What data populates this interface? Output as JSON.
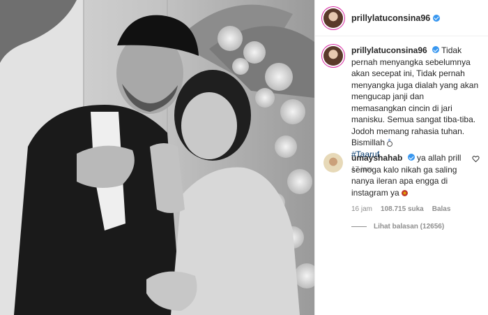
{
  "post": {
    "username": "prillylatuconsina96"
  },
  "caption": {
    "username": "prillylatuconsina96",
    "text": "Tidak pernah menyangka sebelumnya akan secepat ini, Tidak pernah menyangka juga dialah yang akan mengucap janji dan memasangkan cincin di jari manisku. Semua sangat tiba-tiba. Jodoh memang rahasia tuhan. Bismillah",
    "emoji_icon": "ring-icon",
    "hashtag": "#Taaruf",
    "time": "17 jam"
  },
  "comment": {
    "username": "umayshahab",
    "text": "ya allah prill semoga kalo nikah ga saling nanya ileran apa engga di instagram ya",
    "emoji_icon": "flower-icon",
    "time": "16 jam",
    "likes": "108.715 suka",
    "reply_label": "Balas",
    "view_replies": "Lihat balasan (12656)"
  },
  "colors": {
    "verified": "#3897f0",
    "hashtag": "#00376b",
    "muted": "#8e8e8e",
    "text": "#262626"
  }
}
